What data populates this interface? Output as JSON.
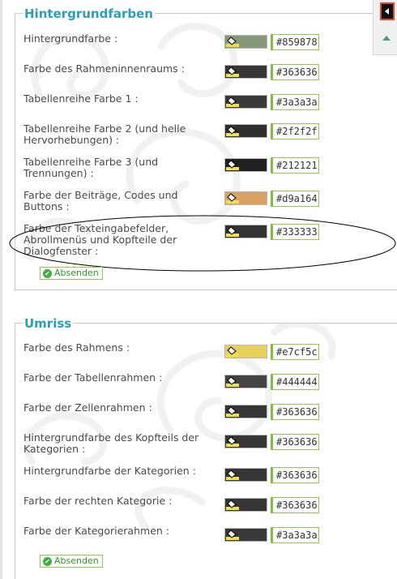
{
  "background_section": {
    "legend": "Hintergrundfarben",
    "rows": [
      {
        "label": "Hintergrundfarbe  :",
        "color": "#859878",
        "hex_value": "#859878"
      },
      {
        "label": "Farbe des Rahmeninnenraums  :",
        "color": "#363636",
        "hex_value": "#363636"
      },
      {
        "label": "Tabellenreihe Farbe 1  :",
        "color": "#3a3a3a",
        "hex_value": "#3a3a3a"
      },
      {
        "label": "Tabellenreihe Farbe 2 (und helle Hervorhebungen)  :",
        "color": "#2f2f2f",
        "hex_value": "#2f2f2f"
      },
      {
        "label": "Tabellenreihe Farbe 3 (und Trennungen)  :",
        "color": "#212121",
        "hex_value": "#212121"
      },
      {
        "label": "Farbe der Beiträge, Codes und Buttons  :",
        "color": "#d9a164",
        "hex_value": "#d9a164"
      },
      {
        "label": "Farbe der Texteingabefelder, Abrollmenüs und Kopfteile der Dialogfenster  :",
        "color": "#333333",
        "hex_value": "#333333"
      }
    ],
    "submit_label": "Absenden"
  },
  "outline_section": {
    "legend": "Umriss",
    "rows": [
      {
        "label": "Farbe des Rahmens  :",
        "color": "#e7cf5c",
        "hex_value": "#e7cf5c"
      },
      {
        "label": "Farbe der Tabellenrahmen  :",
        "color": "#444444",
        "hex_value": "#444444"
      },
      {
        "label": "Farbe der Zellenrahmen  :",
        "color": "#363636",
        "hex_value": "#363636"
      },
      {
        "label": "Hintergrundfarbe des Kopfteils der Kategorien  :",
        "color": "#363636",
        "hex_value": "#363636"
      },
      {
        "label": "Hintergrundfarbe der Kategorien  :",
        "color": "#363636",
        "hex_value": "#363636"
      },
      {
        "label": "Farbe der rechten Kategorie  :",
        "color": "#363636",
        "hex_value": "#363636"
      },
      {
        "label": "Farbe der Kategorierahmen  :",
        "color": "#3a3a3a",
        "hex_value": "#3a3a3a"
      }
    ],
    "submit_label": "Absenden"
  },
  "colors": {
    "legend_text": "#2aa0b8",
    "input_border": "#93c94a",
    "annotation_ellipse": "#000000"
  }
}
